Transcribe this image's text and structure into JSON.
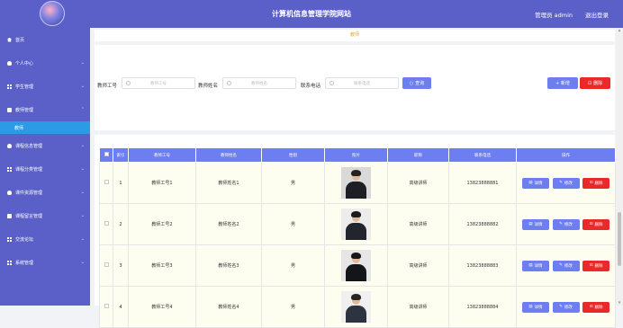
{
  "header": {
    "title": "计算机信息管理学院网站",
    "user": "管理员 admin",
    "logout": "退出登录"
  },
  "sidebar": {
    "items": [
      {
        "label": "首页",
        "icon": "home-icon",
        "chevron": false
      },
      {
        "label": "个人中心",
        "icon": "person-icon",
        "chevron": true
      },
      {
        "label": "学生管理",
        "icon": "grid-icon",
        "chevron": true
      },
      {
        "label": "教师管理",
        "icon": "card-icon",
        "chevron": true,
        "expanded": true,
        "sub": "教师"
      },
      {
        "label": "课程信息管理",
        "icon": "person-icon",
        "chevron": true
      },
      {
        "label": "课程分类管理",
        "icon": "grid-icon",
        "chevron": true
      },
      {
        "label": "课件资源管理",
        "icon": "person-icon",
        "chevron": true
      },
      {
        "label": "课程留言管理",
        "icon": "chat-icon",
        "chevron": true
      },
      {
        "label": "交流论坛",
        "icon": "grid-icon",
        "chevron": true
      },
      {
        "label": "系统管理",
        "icon": "grid-icon",
        "chevron": true
      }
    ]
  },
  "breadcrumb": "教师",
  "search": {
    "teacher_id_label": "教师工号",
    "teacher_id_placeholder": "教师工号",
    "teacher_name_label": "教师姓名",
    "teacher_name_placeholder": "教师姓名",
    "phone_label": "联系电话",
    "phone_placeholder": "联系电话",
    "query_button": "查询",
    "add_button": "+ 新增",
    "delete_button": "删除"
  },
  "table": {
    "headers": [
      "",
      "索引",
      "教师工号",
      "教师姓名",
      "性别",
      "照片",
      "职称",
      "联系电话",
      "操作"
    ],
    "rows": [
      {
        "index": "1",
        "id": "教师工号1",
        "name": "教师姓名1",
        "gender": "男",
        "title": "高级讲师",
        "phone": "13823888881"
      },
      {
        "index": "2",
        "id": "教师工号2",
        "name": "教师姓名2",
        "gender": "男",
        "title": "高级讲师",
        "phone": "13823888882"
      },
      {
        "index": "3",
        "id": "教师工号3",
        "name": "教师姓名3",
        "gender": "男",
        "title": "高级讲师",
        "phone": "13823888883"
      },
      {
        "index": "4",
        "id": "教师工号4",
        "name": "教师姓名4",
        "gender": "男",
        "title": "高级讲师",
        "phone": "13823888884"
      }
    ],
    "actions": {
      "detail": "详情",
      "edit": "修改",
      "delete": "删除"
    }
  },
  "colors": {
    "header_bg": "#5a60c8",
    "accent_blue": "#6d7ef0",
    "danger_red": "#e82a2a",
    "active_sub": "#2c9be6",
    "breadcrumb_text": "#e8a33a"
  }
}
